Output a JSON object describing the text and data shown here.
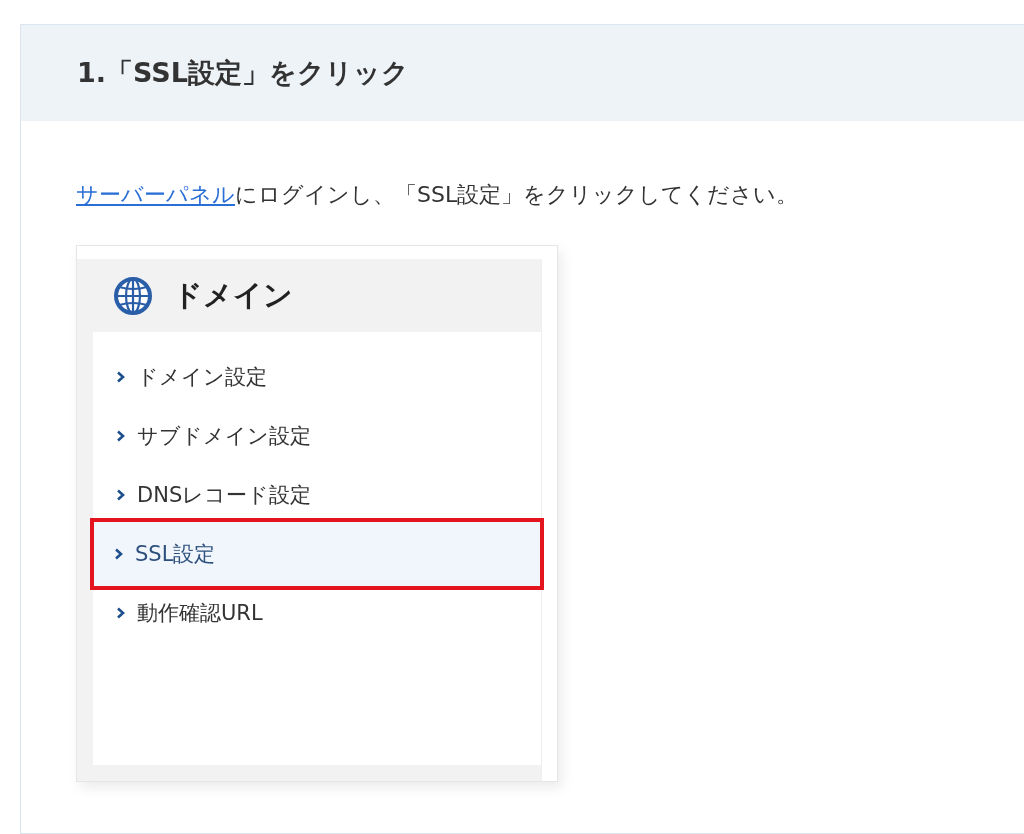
{
  "step": {
    "title": "1.「SSL設定」をクリック"
  },
  "instruction": {
    "link": "サーバーパネル",
    "text": "にログインし、「SSL設定」をクリックしてください。"
  },
  "screenshot": {
    "panel_title": "ドメイン",
    "items": [
      {
        "label": "ドメイン設定",
        "selected": false
      },
      {
        "label": "サブドメイン設定",
        "selected": false
      },
      {
        "label": "DNSレコード設定",
        "selected": false
      },
      {
        "label": "SSL設定",
        "selected": true
      },
      {
        "label": "動作確認URL",
        "selected": false
      }
    ]
  }
}
